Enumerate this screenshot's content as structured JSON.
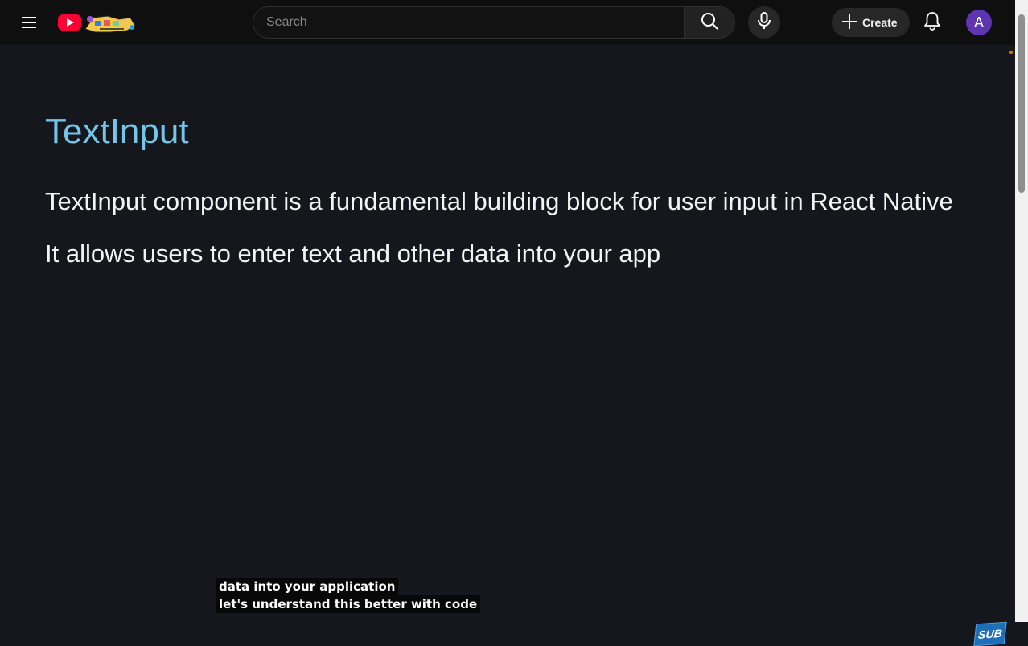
{
  "header": {
    "search_placeholder": "Search",
    "create_label": "Create",
    "avatar_letter": "A"
  },
  "video": {
    "heading": "TextInput",
    "paragraph_1": "TextInput component is a fundamental building block for user input in React Native",
    "paragraph_2": "It allows users to enter text and other data into your app",
    "caption_line_1": "data into your application",
    "caption_line_2": "let's understand this better with code",
    "sub_badge": "SUB"
  },
  "colors": {
    "heading": "#74c5e8",
    "background": "#16171d",
    "avatar": "#5e35b1",
    "logo_red": "#ff0033"
  }
}
